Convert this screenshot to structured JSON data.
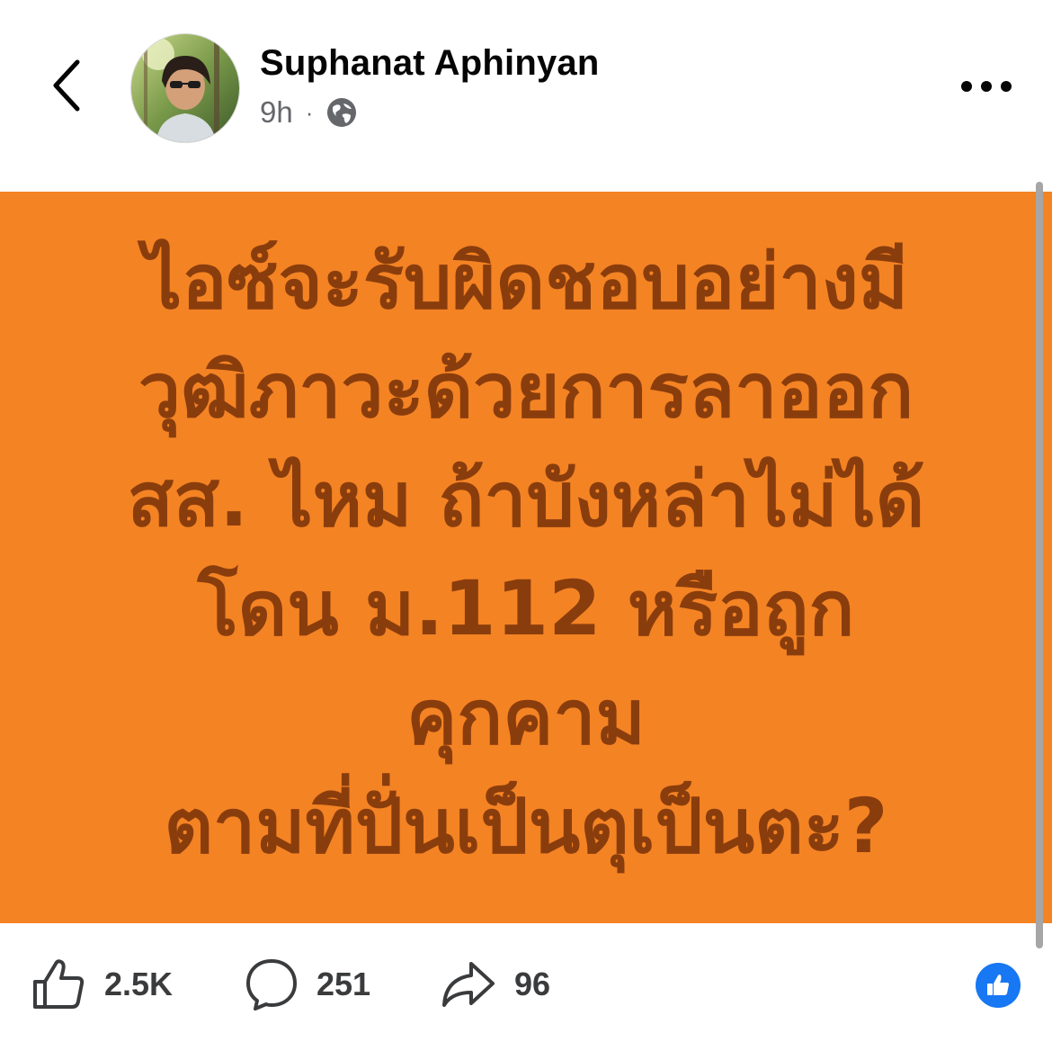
{
  "post": {
    "author_name": "Suphanat Aphinyan",
    "time_ago": "9h",
    "separator": "·",
    "privacy_icon": "globe-icon",
    "text_lines": [
      "ไอซ์จะรับผิดชอบอย่างมี",
      "วุฒิภาวะด้วยการลาออก",
      "สส. ไหม ถ้าบังหล่าไม่ได้",
      "โดน ม.112 หรือถูกคุกคาม",
      "ตามที่ปั่นเป็นตุเป็นตะ?"
    ],
    "background_color": "#f48324",
    "text_color": "#8a3d0c"
  },
  "header": {
    "back_icon": "chevron-left-icon",
    "more_icon": "more-horizontal-icon"
  },
  "footer": {
    "like_count": "2.5K",
    "comment_count": "251",
    "share_count": "96",
    "like_icon": "thumbs-up-outline-icon",
    "comment_icon": "speech-bubble-icon",
    "share_icon": "share-arrow-icon",
    "reaction_icon": "like-reaction-icon",
    "reaction_color": "#1877f2"
  }
}
